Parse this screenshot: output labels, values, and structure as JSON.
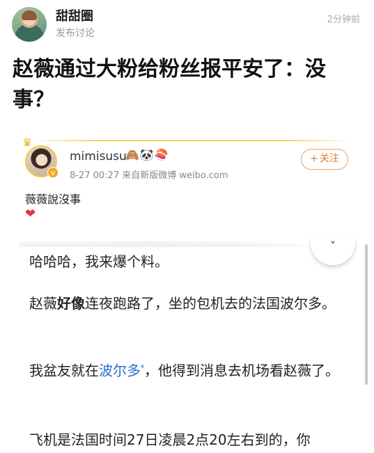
{
  "header": {
    "author_name": "甜甜圈",
    "author_sub": "发布讨论",
    "post_time": "2分钟前"
  },
  "title": "赵薇通过大粉给粉丝报平安了：没事？",
  "weibo_card": {
    "name": "mimisusu",
    "emojis": "🙈🐼🍣",
    "meta": "8-27 00:27  来自新版微博 weibo.com",
    "follow_label": "关注",
    "follow_plus": "+",
    "text": "薇薇說沒事",
    "heart": "❤",
    "vbadge": "v",
    "crown": "♛"
  },
  "inner_post": {
    "collapse_icon": "˅",
    "p1": "哈哈哈，我来爆个料。",
    "p2_before": "赵薇",
    "p2_bold": "好像",
    "p2_after": "连夜跑路了，坐的包机去的法国波尔多。",
    "p3_before": "我盆友就在",
    "p3_link": "波尔多",
    "p3_link_icon": "ᵠ",
    "p3_after": "，他得到消息去机场看赵薇了。",
    "p4": "飞机是法国时间27日凌晨2点20左右到的，你"
  },
  "colors": {
    "accent_orange": "#e07a2f",
    "link_blue": "#2b6fc7",
    "heart_red": "#e8343f"
  }
}
